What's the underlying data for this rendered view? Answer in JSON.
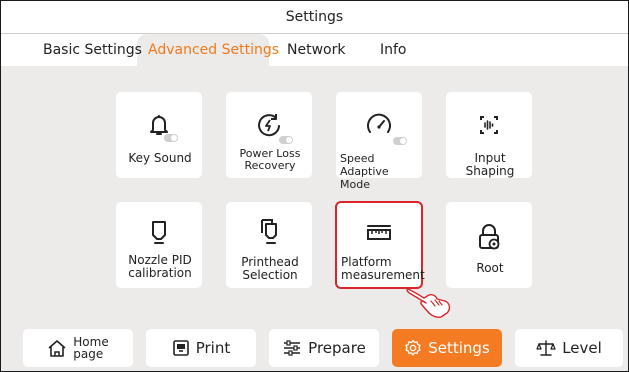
{
  "window": {
    "title": "Settings"
  },
  "tabs": [
    {
      "label": "Basic Settings",
      "active": false
    },
    {
      "label": "Advanced Settings",
      "active": true
    },
    {
      "label": "Network",
      "active": false
    },
    {
      "label": "Info",
      "active": false
    }
  ],
  "cards": [
    {
      "label": "Key Sound",
      "icon": "bell-icon",
      "toggle": true
    },
    {
      "label": "Power Loss Recovery",
      "icon": "power-loss-icon",
      "toggle": true
    },
    {
      "label": "Speed Adaptive Mode",
      "icon": "speedometer-icon",
      "toggle": true
    },
    {
      "label": "Input Shaping",
      "icon": "input-shaping-icon",
      "toggle": false
    },
    {
      "label": "Nozzle PID calibration",
      "icon": "nozzle-icon",
      "toggle": false
    },
    {
      "label": "Printhead Selection",
      "icon": "printhead-icon",
      "toggle": false
    },
    {
      "label": "Platform measurement",
      "icon": "ruler-icon",
      "toggle": false,
      "highlighted": true
    },
    {
      "label": "Root",
      "icon": "lock-icon",
      "toggle": false
    }
  ],
  "bottom_nav": [
    {
      "label": "Home page",
      "line1": "Home",
      "line2": "page",
      "icon": "home-icon",
      "active": false
    },
    {
      "label": "Print",
      "icon": "print-icon",
      "active": false
    },
    {
      "label": "Prepare",
      "icon": "sliders-icon",
      "active": false
    },
    {
      "label": "Settings",
      "icon": "gear-icon",
      "active": true
    },
    {
      "label": "Level",
      "icon": "scale-icon",
      "active": false
    }
  ],
  "colors": {
    "accent": "#f47b22",
    "highlight_border": "#d8262b",
    "background": "#ecebea",
    "card": "#ffffff"
  }
}
